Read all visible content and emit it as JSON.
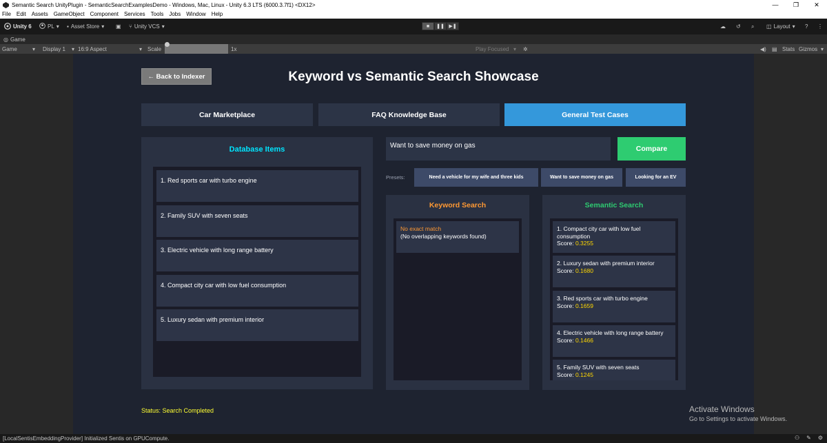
{
  "window": {
    "title": "Semantic Search UnityPlugin - SemanticSearchExamplesDemo - Windows, Mac, Linux - Unity 6.3 LTS (6000.3.7f1) <DX12>"
  },
  "menu": [
    "File",
    "Edit",
    "Assets",
    "GameObject",
    "Component",
    "Services",
    "Tools",
    "Jobs",
    "Window",
    "Help"
  ],
  "toolbar": {
    "unity_label": "Unity 6",
    "account_label": "PL",
    "asset_store_label": "Asset Store",
    "vcs_label": "Unity VCS",
    "layout_label": "Layout"
  },
  "game_tab": {
    "label": "Game"
  },
  "game_bar": {
    "view_select": "Game",
    "display": "Display 1",
    "aspect": "16:9 Aspect",
    "scale_label": "Scale",
    "scale_value": "1x",
    "play_focused": "Play Focused",
    "stats": "Stats",
    "gizmos": "Gizmos"
  },
  "app": {
    "back_button": "← Back to Indexer",
    "title": "Keyword vs Semantic Search Showcase",
    "tabs": [
      {
        "label": "Car Marketplace",
        "active": false
      },
      {
        "label": "FAQ Knowledge Base",
        "active": false
      },
      {
        "label": "General Test Cases",
        "active": true
      }
    ],
    "database": {
      "title": "Database Items",
      "items": [
        "1. Red sports car with turbo engine",
        "2. Family SUV with seven seats",
        "3. Electric vehicle with long range battery",
        "4. Compact city car with low fuel consumption",
        "5. Luxury sedan with premium interior"
      ]
    },
    "query": "Want to save money on gas",
    "compare_button": "Compare",
    "presets": {
      "label": "Presets:",
      "items": [
        "Need a vehicle for my wife and three kids",
        "Want to save money on gas",
        "Looking for an EV"
      ]
    },
    "keyword": {
      "title": "Keyword Search",
      "no_match": "No exact match",
      "detail": "(No overlapping keywords found)"
    },
    "semantic": {
      "title": "Semantic Search",
      "score_label": "Score:",
      "results": [
        {
          "name": "1. Compact city car with low fuel consumption",
          "score": "0.3255"
        },
        {
          "name": "2. Luxury sedan with premium interior",
          "score": "0.1680"
        },
        {
          "name": "3. Red sports car with turbo engine",
          "score": "0.1659"
        },
        {
          "name": "4. Electric vehicle with long range battery",
          "score": "0.1466"
        },
        {
          "name": "5. Family SUV with seven seats",
          "score": "0.1245"
        }
      ]
    },
    "status": "Status: Search Completed"
  },
  "watermark": {
    "line1": "Activate Windows",
    "line2": "Go to Settings to activate Windows."
  },
  "console": {
    "message": "[LocalSentisEmbeddingProvider] Initialized Sentis on GPUCompute."
  },
  "colors": {
    "accent_tab": "#3498db",
    "compare": "#2ecc71",
    "db_title": "#00e5ff",
    "keyword_title": "#ff9933",
    "semantic_title": "#2ecc71",
    "score": "#ffd700",
    "status": "#ffff33"
  }
}
